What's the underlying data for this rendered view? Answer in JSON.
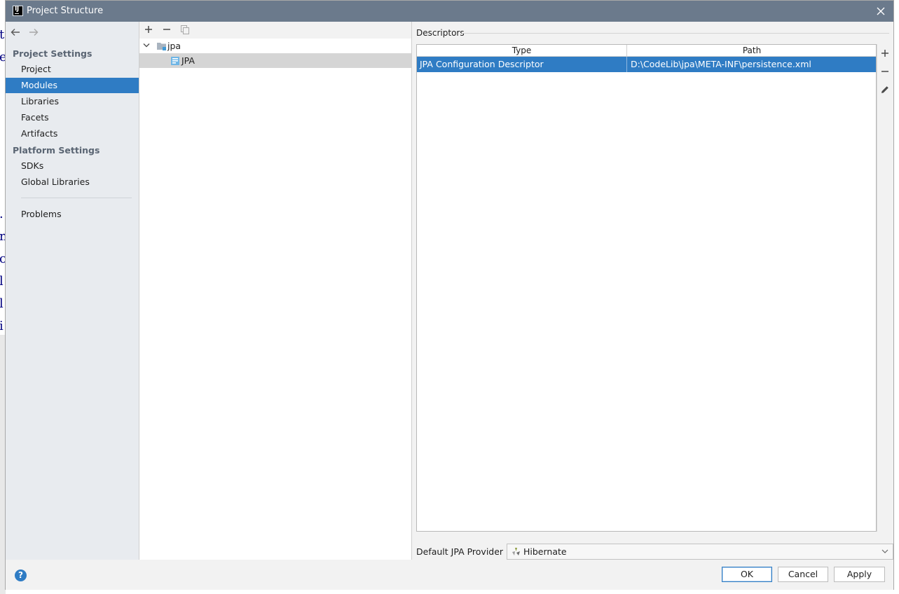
{
  "window": {
    "title": "Project Structure",
    "app_icon": "intellij-idea-icon",
    "close_icon": "close-icon"
  },
  "background_editor": {
    "glyphs": [
      "t",
      "e",
      ".",
      "m",
      "c",
      "l",
      "l",
      "i"
    ]
  },
  "sidebar": {
    "back_icon": "arrow-left-icon",
    "forward_icon": "arrow-right-icon",
    "project_settings_header": "Project Settings",
    "project_settings_items": [
      {
        "label": "Project",
        "selected": false
      },
      {
        "label": "Modules",
        "selected": true
      },
      {
        "label": "Libraries",
        "selected": false
      },
      {
        "label": "Facets",
        "selected": false
      },
      {
        "label": "Artifacts",
        "selected": false
      }
    ],
    "platform_settings_header": "Platform Settings",
    "platform_settings_items": [
      {
        "label": "SDKs"
      },
      {
        "label": "Global Libraries"
      }
    ],
    "problems_label": "Problems"
  },
  "tree": {
    "toolbar": {
      "add_icon": "plus-icon",
      "remove_icon": "minus-icon",
      "copy_icon": "copy-icon"
    },
    "module": {
      "name": "jpa",
      "expanded": true,
      "icon": "module-folder-icon"
    },
    "facet": {
      "name": "JPA",
      "icon": "jpa-facet-icon",
      "selected": true
    }
  },
  "descriptors": {
    "section_label": "Descriptors",
    "columns": [
      "Type",
      "Path"
    ],
    "rows": [
      {
        "type": "JPA Configuration Descriptor",
        "path": "D:\\CodeLib\\jpa\\META-INF\\persistence.xml",
        "selected": true
      }
    ],
    "tools": {
      "add_icon": "plus-icon",
      "remove_icon": "minus-icon",
      "edit_icon": "pencil-icon"
    }
  },
  "provider": {
    "label": "Default JPA Provider",
    "value": "Hibernate",
    "icon": "hibernate-icon"
  },
  "buttons": {
    "ok": "OK",
    "cancel": "Cancel",
    "apply": "Apply",
    "help": "?"
  },
  "colors": {
    "titlebar": "#6b7a8c",
    "selection": "#2f7cc4",
    "sidebar": "#e8ebef",
    "tree_selection": "#d5d5d5"
  }
}
